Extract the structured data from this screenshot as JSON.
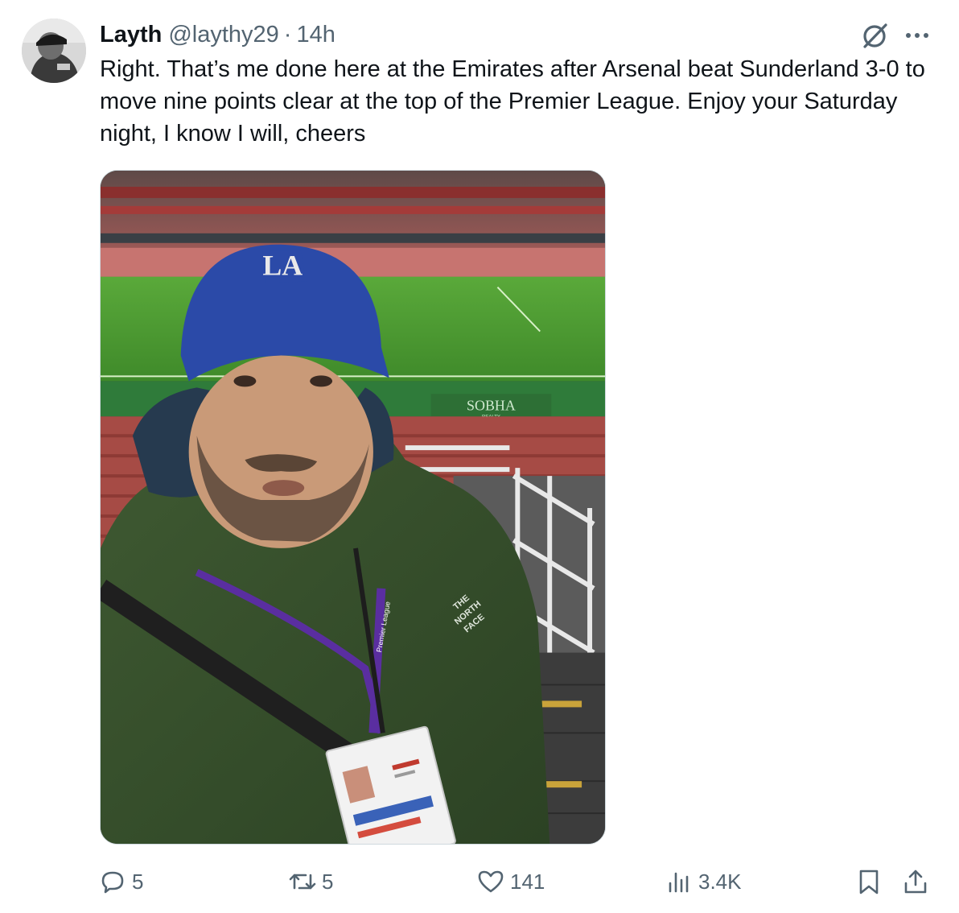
{
  "tweet": {
    "author": {
      "display_name": "Layth",
      "handle": "@laythy29",
      "avatar_icon": "avatar-photo"
    },
    "separator": "·",
    "time": "14h",
    "text": "Right. That’s me done here at the Emirates after Arsenal beat Sunderland 3-0 to move nine points clear at the top of the Premier League. Enjoy your Saturday night, I know I will, cheers",
    "media": {
      "cap_logo_text": "LA",
      "board_text": "SOBHA",
      "board_subtext": "REALTY",
      "jacket_logo_lines": [
        "THE",
        "NORTH",
        "FACE"
      ],
      "lanyard_text": "Premier League"
    },
    "actions": {
      "reply": {
        "icon": "reply-icon",
        "count": "5"
      },
      "retweet": {
        "icon": "retweet-icon",
        "count": "5"
      },
      "like": {
        "icon": "heart-icon",
        "count": "141"
      },
      "views": {
        "icon": "views-icon",
        "count": "3.4K"
      },
      "bookmark": {
        "icon": "bookmark-icon"
      },
      "share": {
        "icon": "share-icon"
      }
    }
  },
  "colors": {
    "text_primary": "#0f1419",
    "text_secondary": "#536471",
    "border": "#cfd9de"
  }
}
